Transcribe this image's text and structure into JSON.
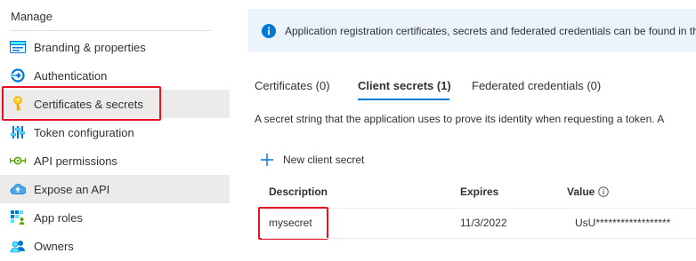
{
  "sidebar": {
    "section_title": "Manage",
    "items": [
      {
        "label": "Branding & properties",
        "icon": "branding-icon"
      },
      {
        "label": "Authentication",
        "icon": "authentication-icon"
      },
      {
        "label": "Certificates & secrets",
        "icon": "key-icon"
      },
      {
        "label": "Token configuration",
        "icon": "token-config-icon"
      },
      {
        "label": "API permissions",
        "icon": "api-permissions-icon"
      },
      {
        "label": "Expose an API",
        "icon": "cloud-icon"
      },
      {
        "label": "App roles",
        "icon": "app-roles-icon"
      },
      {
        "label": "Owners",
        "icon": "owners-icon"
      }
    ],
    "selected_item": "Certificates & secrets"
  },
  "info_bar": {
    "text": "Application registration certificates, secrets and federated credentials can be found in th"
  },
  "tabs": [
    {
      "label": "Certificates (0)"
    },
    {
      "label": "Client secrets (1)"
    },
    {
      "label": "Federated credentials (0)"
    }
  ],
  "active_tab": "Client secrets (1)",
  "description": "A secret string that the application uses to prove its identity when requesting a token. A",
  "new_secret_label": "New client secret",
  "table": {
    "headers": {
      "description": "Description",
      "expires": "Expires",
      "value": "Value"
    },
    "rows": [
      {
        "description": "mysecret",
        "expires": "11/3/2022",
        "value": "UsU******************"
      }
    ]
  },
  "colors": {
    "accent": "#0078d4",
    "highlight": "#e81123",
    "info_background": "#ebf3fc",
    "selected_background": "#edebe9"
  }
}
